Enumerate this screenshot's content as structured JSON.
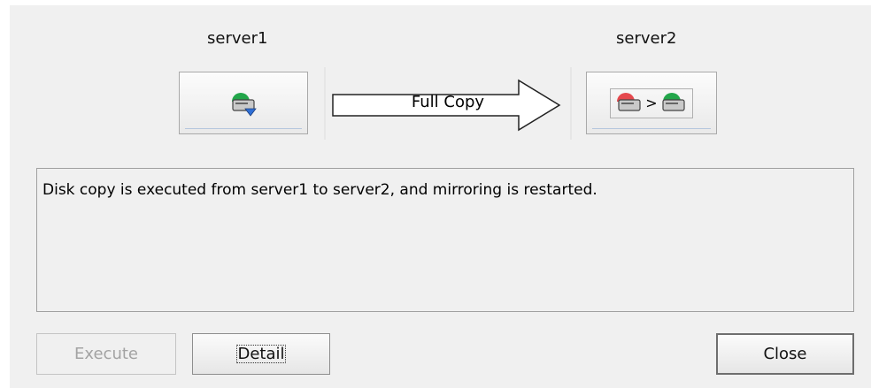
{
  "source_server": {
    "name": "server1"
  },
  "target_server": {
    "name": "server2"
  },
  "operation": {
    "label": "Full Copy"
  },
  "message": "Disk copy is executed from server1 to server2, and mirroring is restarted.",
  "buttons": {
    "execute": "Execute",
    "detail": "Detail",
    "close": "Close"
  },
  "icons": {
    "source": "disk-normal-icon",
    "target": "disk-copy-icon"
  },
  "colors": {
    "status_ok": "#22a64a",
    "status_error": "#e5484d",
    "disk_blue": "#2f6fd6"
  }
}
